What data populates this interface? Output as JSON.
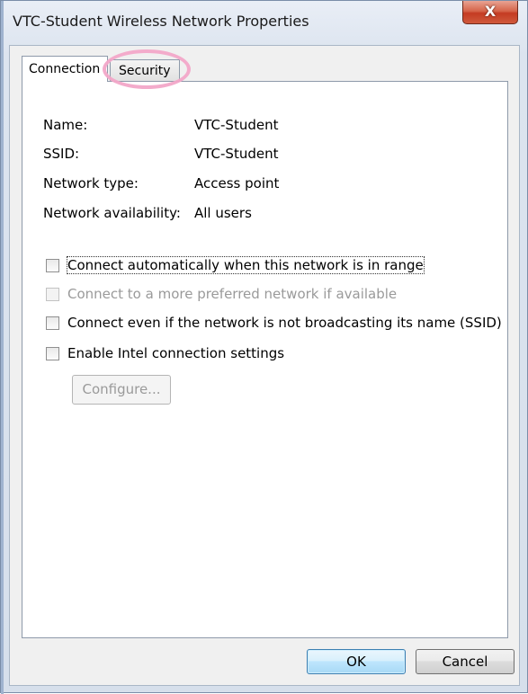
{
  "window": {
    "title": "VTC-Student Wireless Network Properties",
    "close_glyph": "X"
  },
  "tabs": [
    {
      "label": "Connection",
      "active": true
    },
    {
      "label": "Security",
      "active": false
    }
  ],
  "info": [
    {
      "label": "Name:",
      "value": "VTC-Student"
    },
    {
      "label": "SSID:",
      "value": "VTC-Student"
    },
    {
      "label": "Network type:",
      "value": "Access point"
    },
    {
      "label": "Network availability:",
      "value": "All users"
    }
  ],
  "options": [
    {
      "label": "Connect automatically when this network is in range",
      "checked": false,
      "enabled": true
    },
    {
      "label": "Connect to a more preferred network if available",
      "checked": false,
      "enabled": false
    },
    {
      "label": "Connect even if the network is not broadcasting its name (SSID)",
      "checked": false,
      "enabled": true
    },
    {
      "label": "Enable Intel connection settings",
      "checked": false,
      "enabled": true
    }
  ],
  "configure_label": "Configure...",
  "buttons": {
    "ok": "OK",
    "cancel": "Cancel"
  },
  "colors": {
    "highlight_ring": "#f2a6c8",
    "close_button": "#c43b22"
  }
}
